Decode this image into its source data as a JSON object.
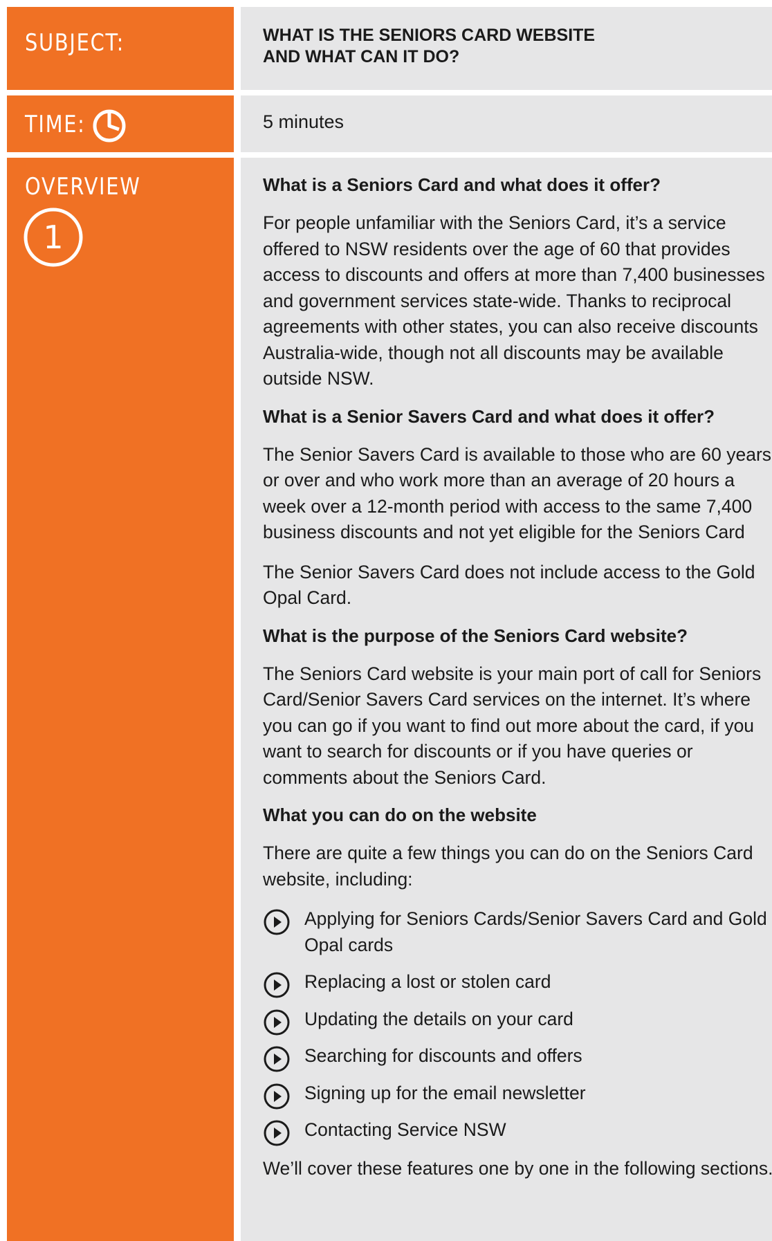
{
  "subject": {
    "label": "SUBJECT:",
    "title_line1": "WHAT IS THE SENIORS CARD WEBSITE",
    "title_line2": "AND WHAT CAN IT DO?"
  },
  "time": {
    "label": "TIME:",
    "value": "5 minutes",
    "icon": "clock-icon"
  },
  "overview": {
    "label": "OVERVIEW",
    "badge": "1",
    "sections": [
      {
        "heading": "What is a Seniors Card and what does it offer?",
        "paragraphs": [
          "For people unfamiliar with the Seniors Card, it’s a service offered to NSW residents over the age of 60 that provides access to discounts and offers at more than 7,400 businesses and government services state-wide. Thanks to reciprocal agreements with other states, you can also receive discounts Australia-wide, though not all discounts may be available outside NSW."
        ]
      },
      {
        "heading": "What is a Senior Savers Card and what does it offer?",
        "paragraphs": [
          "The Senior Savers Card is available to those who are 60 years or over and who work more than an average of 20 hours a week over a 12-month period with access to the same 7,400 business discounts and not yet eligible for the Seniors Card",
          "The Senior Savers Card does not include access to the Gold Opal Card."
        ]
      },
      {
        "heading": "What is the purpose of the Seniors Card website?",
        "paragraphs": [
          "The Seniors Card website is your main port of call for Seniors Card/Senior Savers Card services on the internet. It’s where you can go if you want to find out more about the card, if you want to search for discounts or if you have queries or comments about the Seniors Card."
        ]
      },
      {
        "heading": "What you can do on the website",
        "paragraphs": [
          "There are quite a few things you can do on the Seniors Card website, including:"
        ]
      }
    ],
    "list_items": [
      "Applying for Seniors Cards/Senior Savers Card and Gold Opal cards",
      "Replacing a lost or stolen card",
      "Updating the details on your card",
      "Searching for discounts and offers",
      "Signing up for the email newsletter",
      "Contacting Service NSW"
    ],
    "closing": "We’ll cover these features one by one in the following sections."
  },
  "colors": {
    "accent": "#f07124",
    "panel": "#e6e6e7",
    "text": "#1a1a1a"
  }
}
